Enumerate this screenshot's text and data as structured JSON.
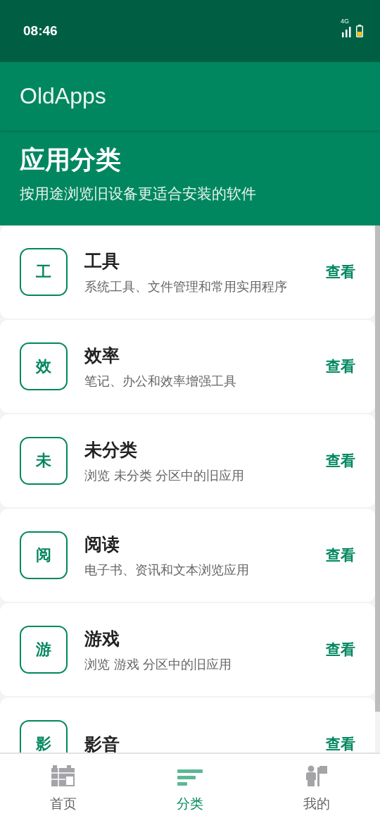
{
  "status_bar": {
    "time": "08:46",
    "network": "4G"
  },
  "app_bar": {
    "title": "OldApps"
  },
  "header": {
    "title": "应用分类",
    "subtitle": "按用途浏览旧设备更适合安装的软件"
  },
  "categories": [
    {
      "badge": "工",
      "name": "工具",
      "description": "系统工具、文件管理和常用实用程序",
      "action": "查看"
    },
    {
      "badge": "效",
      "name": "效率",
      "description": "笔记、办公和效率增强工具",
      "action": "查看"
    },
    {
      "badge": "未",
      "name": "未分类",
      "description": "浏览 未分类 分区中的旧应用",
      "action": "查看"
    },
    {
      "badge": "阅",
      "name": "阅读",
      "description": "电子书、资讯和文本浏览应用",
      "action": "查看"
    },
    {
      "badge": "游",
      "name": "游戏",
      "description": "浏览 游戏 分区中的旧应用",
      "action": "查看"
    },
    {
      "badge": "影",
      "name": "影音",
      "action": "查看"
    }
  ],
  "bottom_nav": [
    {
      "kind": "home",
      "label": "首页",
      "selected": false
    },
    {
      "kind": "category",
      "label": "分类",
      "selected": true
    },
    {
      "kind": "profile",
      "label": "我的",
      "selected": false
    }
  ]
}
